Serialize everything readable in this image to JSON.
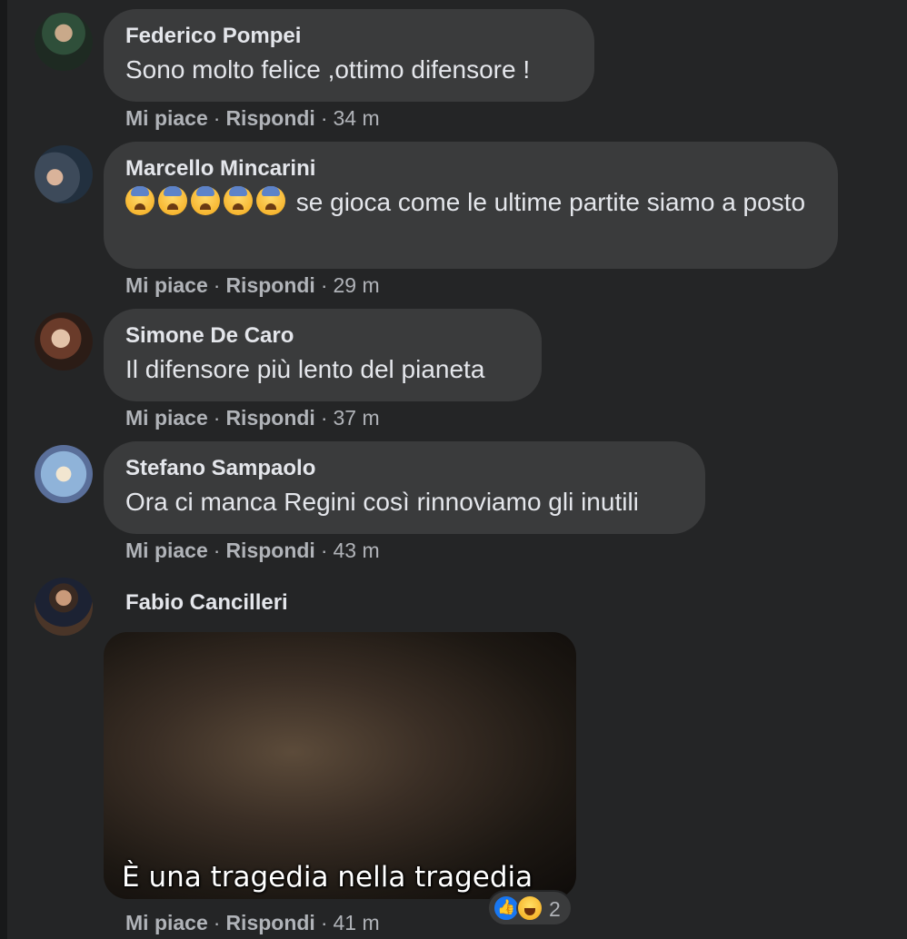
{
  "actions": {
    "like": "Mi piace",
    "reply": "Rispondi",
    "sep": "·"
  },
  "comments": [
    {
      "author": "Federico Pompei",
      "text": "Sono molto felice ,ottimo difensore !",
      "time": "34 m"
    },
    {
      "author": "Marcello Mincarini",
      "text": "se gioca come le ultime partite siamo a posto",
      "time": "29 m",
      "emoji_icons": [
        "anxious-face-icon",
        "anxious-face-icon",
        "anxious-face-icon",
        "anxious-face-icon",
        "anxious-face-icon"
      ]
    },
    {
      "author": "Simone De Caro",
      "text": "Il difensore più lento del pianeta",
      "time": "37 m"
    },
    {
      "author": "Stefano Sampaolo",
      "text": "Ora ci manca Regini così rinnoviamo gli inutili",
      "time": "43 m"
    },
    {
      "author": "Fabio Cancilleri",
      "gif_caption": "È una tragedia nella tragedia",
      "time": "41 m",
      "reactions": {
        "icons": [
          "like-reaction-icon",
          "haha-reaction-icon"
        ],
        "count": "2"
      }
    }
  ],
  "colors": {
    "page_bg": "#18191a",
    "panel_bg": "#242526",
    "bubble_bg": "#3a3b3c",
    "text": "#e4e6eb",
    "secondary_text": "#b0b3b8",
    "like_blue": "#1877f2"
  }
}
